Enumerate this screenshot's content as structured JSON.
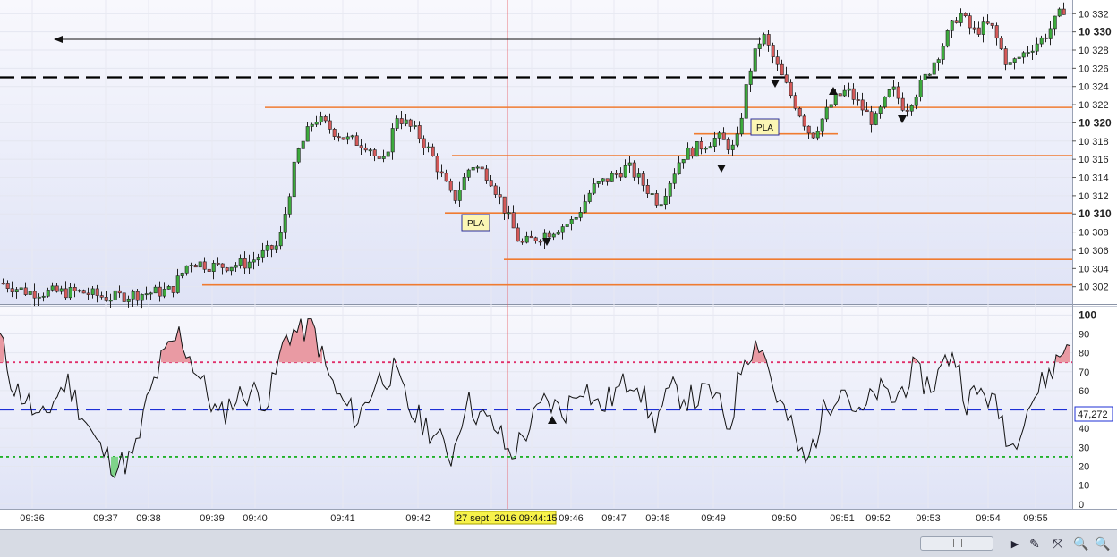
{
  "chart_data": [
    {
      "type": "candlestick",
      "yaxis": {
        "ticks": [
          "10 332",
          "10 330",
          "10 328",
          "10 326",
          "10 324",
          "10 322",
          "10 320",
          "10 318",
          "10 316",
          "10 314",
          "10 312",
          "10 310",
          "10 308",
          "10 306",
          "10 304",
          "10 302"
        ],
        "tick_values": [
          10332,
          10330,
          10328,
          10326,
          10324,
          10322,
          10320,
          10318,
          10316,
          10314,
          10312,
          10310,
          10308,
          10306,
          10304,
          10302
        ],
        "bold_ticks": [
          "10 330",
          "10 320",
          "10 310"
        ],
        "range": [
          10300.3,
          10333.5
        ]
      },
      "horizontal_lines": [
        {
          "level": 10325.0,
          "style": "dashed",
          "color": "#000000"
        },
        {
          "level": 10321.7,
          "color": "#f07b30"
        },
        {
          "level": 10318.8,
          "color": "#f07b30"
        },
        {
          "level": 10316.4,
          "color": "#f07b30"
        },
        {
          "level": 10310.1,
          "color": "#f07b30"
        },
        {
          "level": 10305.0,
          "color": "#f07b30"
        },
        {
          "level": 10302.2,
          "color": "#f07b30"
        }
      ],
      "annotations": [
        {
          "text": "PLA",
          "at": "09:43"
        },
        {
          "text": "PLA",
          "at": "09:49"
        }
      ],
      "colors": {
        "up": "#3caa3c",
        "down": "#d45a5a"
      }
    },
    {
      "type": "line",
      "yaxis": {
        "ticks": [
          "100",
          "90",
          "80",
          "70",
          "60",
          "50",
          "40",
          "30",
          "20",
          "10",
          "0"
        ],
        "tick_values": [
          100,
          90,
          80,
          70,
          60,
          50,
          40,
          30,
          20,
          10,
          0
        ],
        "range": [
          -2,
          103
        ]
      },
      "reference_lines": [
        {
          "level": 75,
          "style": "dotted",
          "color": "#e0306a"
        },
        {
          "level": 50,
          "style": "dashed",
          "color": "#1d2fd6"
        },
        {
          "level": 25,
          "style": "dotted",
          "color": "#22b22a"
        }
      ],
      "last_value": "47,272",
      "overbought_fill": "#e99aa3",
      "oversold_fill": "#7fd38a"
    }
  ],
  "xaxis": {
    "labels": [
      "09:36",
      "09:37",
      "09:38",
      "09:39",
      "09:40",
      "09:41",
      "09:42",
      "09:43",
      "09:44",
      "09:46",
      "09:47",
      "09:48",
      "09:49",
      "09:50",
      "09:51",
      "09:52",
      "09:53",
      "09:54",
      "09:55"
    ],
    "cursor_label": "27 sept. 2016 09:44:15"
  },
  "toolbar": {
    "icons": [
      "play-icon",
      "chart-tool-icon",
      "zoom-fit-icon",
      "zoom-out-icon",
      "zoom-in-icon"
    ],
    "glyphs": [
      "▶",
      "✎",
      "⤧",
      "🔍",
      "🔍"
    ]
  }
}
